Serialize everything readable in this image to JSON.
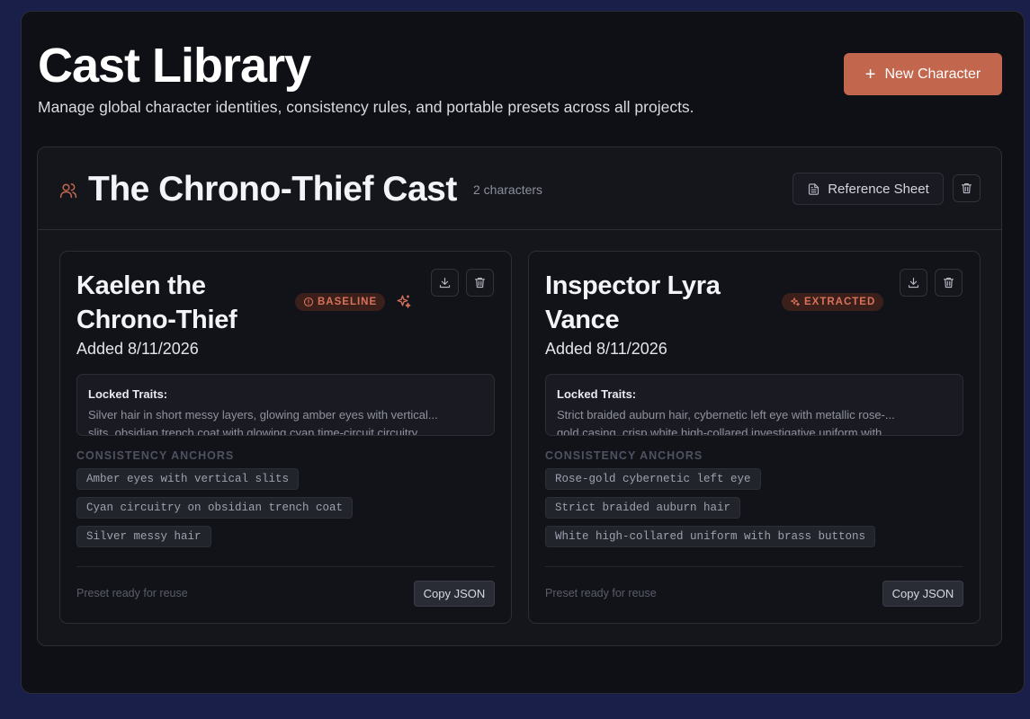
{
  "header": {
    "title": "Cast Library",
    "subtitle": "Manage global character identities, consistency rules, and portable presets across all projects.",
    "new_button": "New Character"
  },
  "group": {
    "title": "The Chrono-Thief Cast",
    "count": "2 characters",
    "reference_button": "Reference Sheet"
  },
  "characters": [
    {
      "name": "Kaelen the Chrono-Thief",
      "badge": "BASELINE",
      "badge_icon": "alert-circle-icon",
      "added": "Added 8/11/2026",
      "traits_label": "Locked Traits:",
      "traits_line1": "Silver hair in short messy layers, glowing amber eyes with vertical...",
      "traits_line2": "slits, obsidian trench coat with glowing cyan time-circuit circuitry",
      "anchors_label": "CONSISTENCY ANCHORS",
      "anchors": [
        "Amber eyes with vertical slits",
        "Cyan circuitry on obsidian trench coat",
        "Silver messy hair"
      ],
      "preset_note": "Preset ready for reuse",
      "copy_button": "Copy JSON"
    },
    {
      "name": "Inspector Lyra Vance",
      "badge": "EXTRACTED",
      "badge_icon": "sparkles-icon",
      "added": "Added 8/11/2026",
      "traits_label": "Locked Traits:",
      "traits_line1": "Strict braided auburn hair, cybernetic left eye with metallic rose-...",
      "traits_line2": "gold casing, crisp white high-collared investigative uniform with",
      "anchors_label": "CONSISTENCY ANCHORS",
      "anchors": [
        "Rose-gold cybernetic left eye",
        "Strict braided auburn hair",
        "White high-collared uniform with brass buttons"
      ],
      "preset_note": "Preset ready for reuse",
      "copy_button": "Copy JSON"
    }
  ],
  "colors": {
    "accent": "#c2674e",
    "badge_text": "#d9725a",
    "badge_bg": "#3a1f1b",
    "background": "#0f1015"
  }
}
